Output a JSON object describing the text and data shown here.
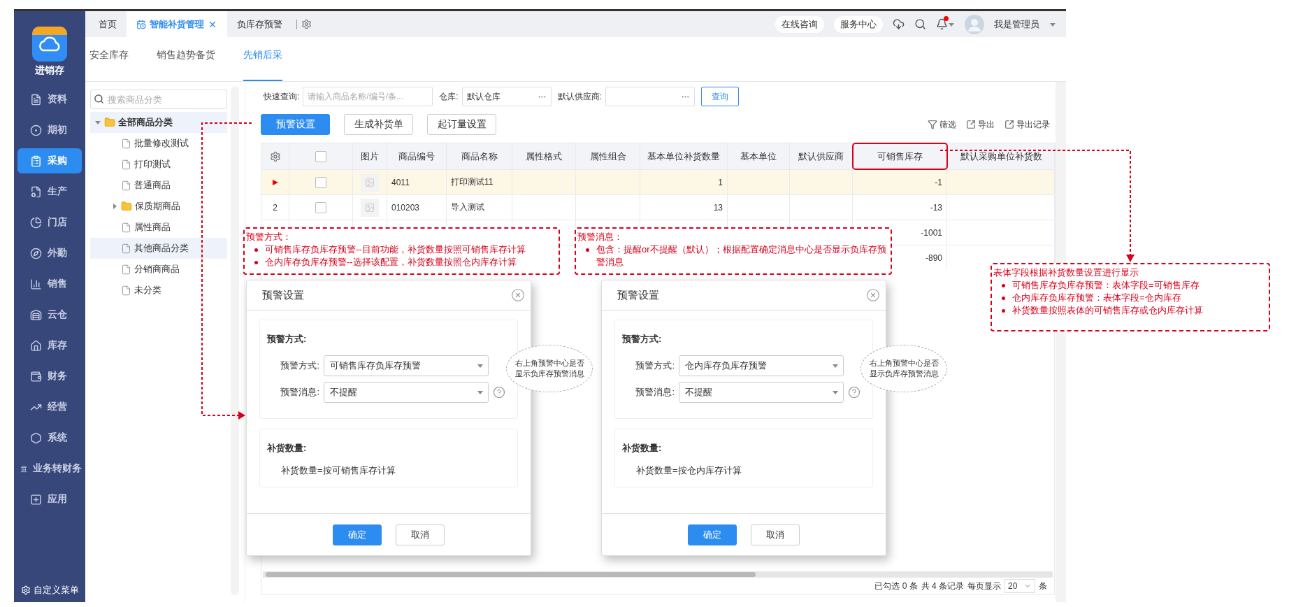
{
  "sidebar": {
    "app_name": "进销存",
    "items": [
      {
        "label": "资料",
        "selected": false
      },
      {
        "label": "期初",
        "selected": false
      },
      {
        "label": "采购",
        "selected": true
      },
      {
        "label": "生产",
        "selected": false
      },
      {
        "label": "门店",
        "selected": false
      },
      {
        "label": "外勤",
        "selected": false
      },
      {
        "label": "销售",
        "selected": false
      },
      {
        "label": "云仓",
        "selected": false
      },
      {
        "label": "库存",
        "selected": false
      },
      {
        "label": "财务",
        "selected": false
      },
      {
        "label": "经营",
        "selected": false
      },
      {
        "label": "系统",
        "selected": false
      },
      {
        "label": "业务转财务",
        "selected": false
      },
      {
        "label": "应用",
        "selected": false
      }
    ],
    "footer": "自定义菜单"
  },
  "tabs": [
    {
      "label": "首页",
      "selected": false,
      "closable": false
    },
    {
      "label": "智能补货管理",
      "selected": true,
      "closable": true
    },
    {
      "label": "负库存预警",
      "selected": false,
      "closable": false
    }
  ],
  "header": {
    "links": [
      "在线咨询",
      "服务中心"
    ],
    "unread": true,
    "user": "我是管理员"
  },
  "subtabs": [
    {
      "label": "安全库存",
      "selected": false
    },
    {
      "label": "销售趋势备货",
      "selected": false
    },
    {
      "label": "先销后采",
      "selected": true
    }
  ],
  "tree": {
    "search": {
      "placeholder": "搜索商品分类"
    },
    "items": [
      {
        "label": "全部商品分类",
        "kind": "folder",
        "expanded": true,
        "selected": true,
        "children": [
          {
            "label": "批量修改测试",
            "kind": "file",
            "selected": false
          },
          {
            "label": "打印测试",
            "kind": "file",
            "selected": false
          },
          {
            "label": "普通商品",
            "kind": "file",
            "selected": false
          },
          {
            "label": "保质期商品",
            "kind": "folder",
            "expanded": false,
            "selected": false
          },
          {
            "label": "属性商品",
            "kind": "file",
            "selected": false
          },
          {
            "label": "其他商品分类",
            "kind": "file",
            "selected": true
          },
          {
            "label": "分销商商品",
            "kind": "file",
            "selected": false
          },
          {
            "label": "未分类",
            "kind": "file",
            "selected": false
          }
        ]
      }
    ]
  },
  "filters": [
    {
      "label": "快速查询:",
      "kind": "text",
      "placeholder": "请输入商品名称/编号/条..."
    },
    {
      "label": "仓库:",
      "kind": "picker",
      "value": "默认仓库"
    },
    {
      "label": "默认供应商:",
      "kind": "picker"
    }
  ],
  "search_button": "查询",
  "actions": [
    {
      "label": "预警设置",
      "primary": true
    },
    {
      "label": "生成补货单",
      "primary": false
    },
    {
      "label": "起订量设置",
      "primary": false
    }
  ],
  "tools": [
    {
      "label": "筛选",
      "kind": "filter"
    },
    {
      "label": "导出",
      "kind": "export"
    },
    {
      "label": "导出记录",
      "kind": "export"
    }
  ],
  "table": {
    "select_all": {
      "checked": false
    },
    "columns": [
      {
        "label": "图片",
        "marked": false
      },
      {
        "label": "商品编号",
        "marked": false
      },
      {
        "label": "商品名称",
        "marked": false
      },
      {
        "label": "属性格式",
        "marked": false
      },
      {
        "label": "属性组合",
        "marked": false
      },
      {
        "label": "基本单位补货数量",
        "marked": false
      },
      {
        "label": "基本单位",
        "marked": false
      },
      {
        "label": "默认供应商",
        "marked": false
      },
      {
        "label": "可销售库存",
        "marked": true
      },
      {
        "label": "默认采购单位补货数",
        "marked": false
      }
    ],
    "rows": [
      {
        "selected": true,
        "checked": false,
        "image": true,
        "code": "4011",
        "name": "打印测试11",
        "qty": "1",
        "stock": "-1"
      },
      {
        "selected": false,
        "index": "2",
        "checked": false,
        "image": true,
        "code": "010203",
        "name": "导入测试",
        "qty": "13",
        "stock": "-13"
      },
      {
        "selected": false,
        "stock": "-1001"
      },
      {
        "selected": false,
        "stock": "-890"
      }
    ]
  },
  "footer": {
    "selected": "已勾选 0 条",
    "total": "共 4 条记录",
    "per_page_label": "每页显示",
    "per_page": "20",
    "unit": "条"
  },
  "dialogs": [
    {
      "title": "预警设置",
      "section_1": "预警方式:",
      "fields": [
        {
          "label": "预警方式:",
          "value": "可销售库存负库存预警",
          "help": false
        },
        {
          "label": "预警消息:",
          "value": "不提醒",
          "help": true
        }
      ],
      "section_2": "补货数量:",
      "formula": "补货数量=按可销售库存计算",
      "buttons": [
        {
          "label": "确定",
          "primary": true
        },
        {
          "label": "取消",
          "primary": false
        }
      ],
      "tip": "右上角预警中心是否显示负库存预警消息"
    },
    {
      "title": "预警设置",
      "section_1": "预警方式:",
      "fields": [
        {
          "label": "预警方式:",
          "value": "仓内库存负库存预警",
          "help": false
        },
        {
          "label": "预警消息:",
          "value": "不提醒",
          "help": true
        }
      ],
      "section_2": "补货数量:",
      "formula": "补货数量=按仓内库存计算",
      "buttons": [
        {
          "label": "确定",
          "primary": true
        },
        {
          "label": "取消",
          "primary": false
        }
      ],
      "tip": "右上角预警中心是否显示负库存预警消息"
    }
  ],
  "notes": [
    {
      "title": "预警方式：",
      "bullets": [
        "可销售库存负库存预警--目前功能，补货数量按照可销售库存计算",
        "仓内库存负库存预警--选择该配置，补货数量按照仓内库存计算"
      ]
    },
    {
      "title": "预警消息：",
      "bullets": [
        "包含：提醒or不提醒（默认）；根据配置确定消息中心是否显示负库存预警消息"
      ]
    },
    {
      "title": "表体字段根据补货数量设置进行显示",
      "bullets": [
        "可销售库存负库存预警：表体字段=可销售库存",
        "仓内库存负库存预警：表体字段=仓内库存",
        "补货数量按照表体的可销售库存或仓内库存计算"
      ]
    }
  ]
}
